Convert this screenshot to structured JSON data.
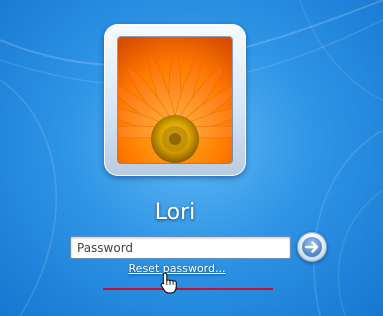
{
  "user": {
    "name": "Lori",
    "tile_picture": "orange-gerbera-daisy-icon"
  },
  "password": {
    "placeholder": "Password",
    "value": ""
  },
  "submit": {
    "icon": "arrow-right-icon"
  },
  "reset": {
    "label": "Reset password..."
  },
  "colors": {
    "background": "#2f95e6",
    "annotation_underline": "#c8102e",
    "petal": "#ff8a00",
    "flower_center": "#d9a400"
  }
}
